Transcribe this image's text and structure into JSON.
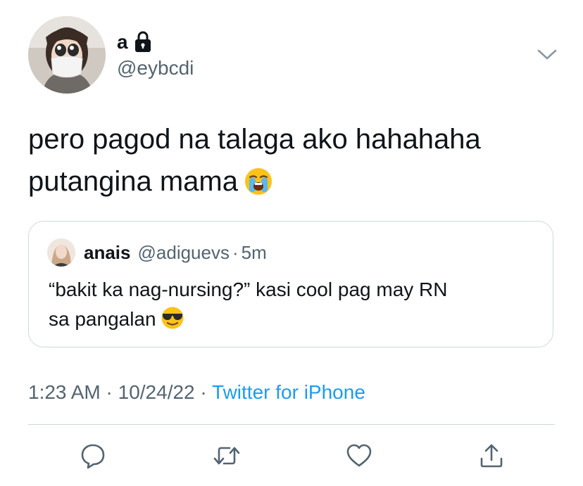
{
  "author": {
    "display_name": "a",
    "handle": "@eybcdi",
    "protected_icon": "lock-icon",
    "avatar_icon": "profile-photo"
  },
  "menu_icon": "chevron-down-icon",
  "tweet": {
    "line1": "pero pagod na talaga ako hahahaha",
    "line2": "putangina mama",
    "emoji": "loudly-crying-face"
  },
  "quote": {
    "name": "anais",
    "handle": "@adiguevs",
    "separator": "·",
    "time": "5m",
    "line1": "“bakit ka nag-nursing?” kasi cool pag may RN",
    "line2": "sa pangalan",
    "emoji": "smiling-face-with-sunglasses"
  },
  "meta": {
    "time": "1:23 AM",
    "sep1": "·",
    "date": "10/24/22",
    "sep2": "·",
    "source": "Twitter for iPhone"
  },
  "actions": [
    "reply-icon",
    "retweet-icon",
    "like-icon",
    "share-icon"
  ],
  "colors": {
    "text": "#0f1419",
    "secondary": "#536471",
    "link": "#1d9bf0",
    "border": "#cfd9de"
  }
}
